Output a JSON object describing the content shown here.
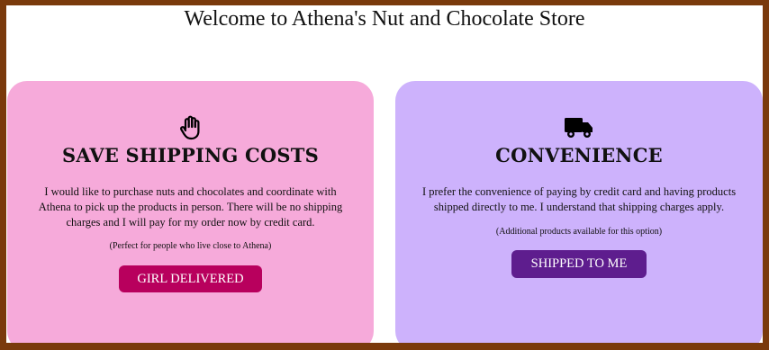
{
  "page": {
    "title": "Welcome to Athena's Nut and Chocolate Store"
  },
  "cards": [
    {
      "icon": "hand-icon",
      "title": "SAVE SHIPPING COSTS",
      "body": "I would like to purchase nuts and chocolates and coordinate with Athena to pick up the products in person. There will be no shipping charges and I will pay for my order now by credit card.",
      "note": "(Perfect for people who live close to Athena)",
      "button_label": "GIRL DELIVERED",
      "background": "#f6aada",
      "button_color": "#b8005d"
    },
    {
      "icon": "truck-icon",
      "title": "CONVENIENCE",
      "body": "I prefer the convenience of paying by credit card and having products shipped directly to me. I understand that shipping charges apply.",
      "note": "(Additional products available for this option)",
      "button_label": "SHIPPED TO ME",
      "background": "#cdb2fc",
      "button_color": "#5e1d8e"
    }
  ],
  "colors": {
    "border": "#7a3a0c"
  }
}
